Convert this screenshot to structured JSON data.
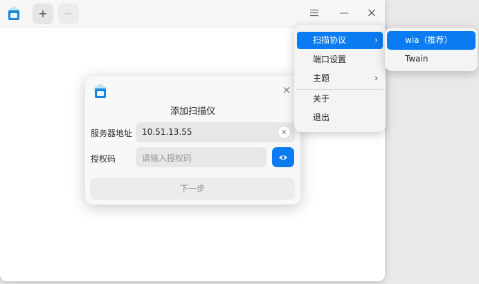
{
  "titlebar": {
    "add_button_label": "+",
    "remove_button_label": "−",
    "menu_icon": "hamburger-icon",
    "minimize_label": "—",
    "close_label": "×"
  },
  "menu": {
    "items": [
      {
        "label": "扫描协议",
        "has_submenu": true
      },
      {
        "label": "端口设置",
        "has_submenu": false
      },
      {
        "label": "主题",
        "has_submenu": true
      },
      {
        "label": "关于",
        "has_submenu": false
      },
      {
        "label": "退出",
        "has_submenu": false
      }
    ],
    "arrow": "›"
  },
  "submenu": {
    "items": [
      {
        "label": "wia（推荐）"
      },
      {
        "label": "Twain"
      }
    ]
  },
  "dialog": {
    "title": "添加扫描仪",
    "close_label": "×",
    "server_label": "服务器地址",
    "server_value": "10.51.13.55",
    "clear_label": "×",
    "auth_label": "授权码",
    "auth_placeholder": "请输入授权码",
    "next_label": "下一步"
  },
  "colors": {
    "accent": "#0a7bf1",
    "window_bg": "#ffffff",
    "titlebar_bg": "#f7f7f7"
  }
}
